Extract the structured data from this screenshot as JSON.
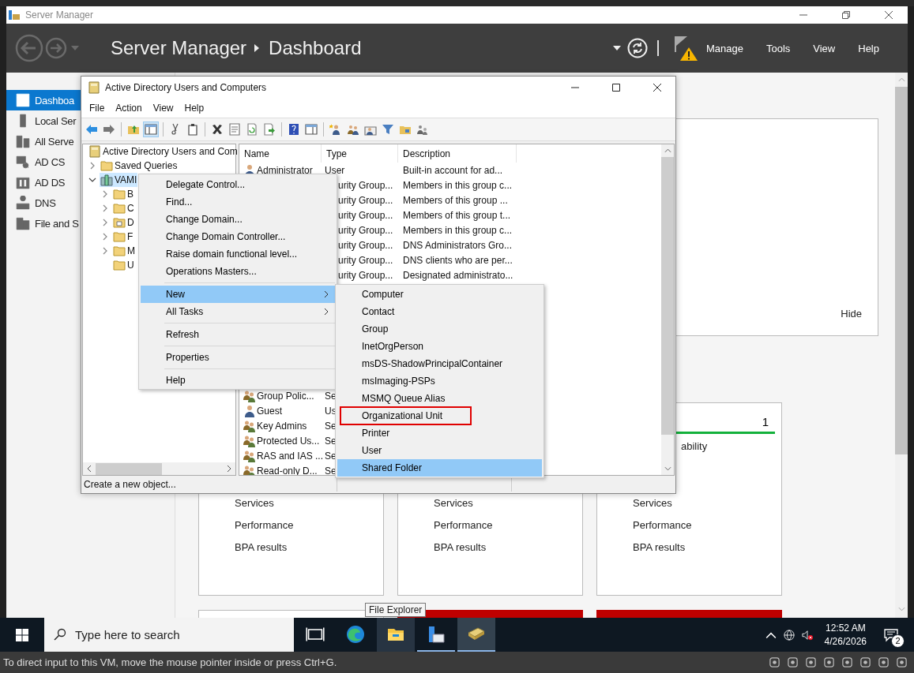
{
  "server_manager": {
    "title": "Server Manager",
    "breadcrumb": [
      "Server Manager",
      "Dashboard"
    ],
    "menu": [
      "Manage",
      "Tools",
      "View",
      "Help"
    ],
    "warning": true,
    "sidebar": [
      {
        "label": "Dashboa",
        "selected": true
      },
      {
        "label": "Local Ser",
        "selected": false
      },
      {
        "label": "All Serve",
        "selected": false
      },
      {
        "label": "AD CS",
        "selected": false
      },
      {
        "label": "AD DS",
        "selected": false
      },
      {
        "label": "DNS",
        "selected": false
      },
      {
        "label": "File and S",
        "selected": false
      }
    ],
    "welcome": {
      "hide": "Hide"
    },
    "tiles": [
      {
        "lines": [
          "Services",
          "Performance",
          "BPA results"
        ]
      },
      {
        "lines": [
          "Services",
          "Performance",
          "BPA results"
        ]
      },
      {
        "count": "1",
        "status": "ability",
        "lines": [
          "Services",
          "Performance",
          "BPA results"
        ]
      }
    ],
    "lower_tiles": [
      {
        "alert": false
      },
      {
        "alert": true
      },
      {
        "alert": true
      }
    ]
  },
  "aduc": {
    "title": "Active Directory Users and Computers",
    "menu": [
      "File",
      "Action",
      "View",
      "Help"
    ],
    "console_tree_pressed": true,
    "tree": [
      {
        "label": "Active Directory Users and Com",
        "kind": "root",
        "selected": false,
        "children": [
          {
            "label": "Saved Queries",
            "kind": "folder",
            "selected": false,
            "expanded": false
          },
          {
            "label": "VAMI",
            "kind": "domain",
            "selected": true,
            "expanded": true,
            "children": [
              {
                "label": "B",
                "kind": "folder",
                "selected": false,
                "expanded": false
              },
              {
                "label": "C",
                "kind": "folder",
                "selected": false,
                "expanded": false
              },
              {
                "label": "D",
                "kind": "ou",
                "selected": false,
                "expanded": false
              },
              {
                "label": "F",
                "kind": "folder",
                "selected": false,
                "expanded": false
              },
              {
                "label": "M",
                "kind": "folder",
                "selected": false,
                "expanded": false
              },
              {
                "label": "U",
                "kind": "folder",
                "selected": false
              }
            ]
          }
        ]
      }
    ],
    "columns": [
      "Name",
      "Type",
      "Description"
    ],
    "rows": [
      {
        "kind": "user",
        "name": "Administrator",
        "type": "User",
        "description": "Built-in account for ad..."
      },
      {
        "type": "urity Group...",
        "description": "Members in this group c..."
      },
      {
        "type": "urity Group...",
        "description": "Members of this group ..."
      },
      {
        "type": "urity Group...",
        "description": "Members of this group t..."
      },
      {
        "type": "urity Group...",
        "description": "Members in this group c..."
      },
      {
        "type": "urity Group...",
        "description": "DNS Administrators Gro..."
      },
      {
        "type": "urity Group...",
        "description": "DNS clients who are per..."
      },
      {
        "type": "urity Group...",
        "description": "Designated administrato..."
      }
    ],
    "rows_below_menu": [
      {
        "kind": "group",
        "name": "Group Polic...",
        "type": "Se"
      },
      {
        "kind": "user",
        "name": "Guest",
        "type": "Us"
      },
      {
        "kind": "group",
        "name": "Key Admins",
        "type": "Se"
      },
      {
        "kind": "group",
        "name": "Protected Us...",
        "type": "Se"
      },
      {
        "kind": "group",
        "name": "RAS and IAS ...",
        "type": "Se"
      },
      {
        "kind": "group",
        "name": "Read-only D...",
        "type": "Se"
      }
    ],
    "status": "Create a new object..."
  },
  "context_menu": [
    [
      {
        "label": "Delegate Control...",
        "selected": false
      },
      {
        "label": "Find...",
        "selected": false
      },
      {
        "label": "Change Domain...",
        "selected": false
      },
      {
        "label": "Change Domain Controller...",
        "selected": false
      },
      {
        "label": "Raise domain functional level...",
        "selected": false
      },
      {
        "label": "Operations Masters...",
        "selected": false
      }
    ],
    [
      {
        "label": "New",
        "selected": true,
        "submenu": true
      },
      {
        "label": "All Tasks",
        "selected": false,
        "submenu": true
      }
    ],
    [
      {
        "label": "Refresh",
        "selected": false
      }
    ],
    [
      {
        "label": "Properties",
        "selected": false
      }
    ],
    [
      {
        "label": "Help",
        "selected": false
      }
    ]
  ],
  "submenu": [
    {
      "label": "Computer",
      "selected": false,
      "outlined": false
    },
    {
      "label": "Contact",
      "selected": false,
      "outlined": false
    },
    {
      "label": "Group",
      "selected": false,
      "outlined": false
    },
    {
      "label": "InetOrgPerson",
      "selected": false,
      "outlined": false
    },
    {
      "label": "msDS-ShadowPrincipalContainer",
      "selected": false,
      "outlined": false
    },
    {
      "label": "msImaging-PSPs",
      "selected": false,
      "outlined": false
    },
    {
      "label": "MSMQ Queue Alias",
      "selected": false,
      "outlined": false
    },
    {
      "label": "Organizational Unit",
      "selected": false,
      "outlined": true
    },
    {
      "label": "Printer",
      "selected": false,
      "outlined": false
    },
    {
      "label": "User",
      "selected": false,
      "outlined": false
    },
    {
      "label": "Shared Folder",
      "selected": true,
      "outlined": false
    }
  ],
  "tooltip": "File Explorer",
  "taskbar": {
    "placeholder": "Type here to search",
    "apps": [
      {
        "kind": "task-view",
        "open": false,
        "selected": false,
        "hovered": false
      },
      {
        "kind": "edge",
        "open": false,
        "selected": false,
        "hovered": false
      },
      {
        "kind": "explorer",
        "open": false,
        "selected": false,
        "hovered": true
      },
      {
        "kind": "server-manager",
        "open": true,
        "selected": false,
        "hovered": false
      },
      {
        "kind": "aduc",
        "open": true,
        "selected": true,
        "hovered": false
      }
    ],
    "time": "12:52 AM",
    "date": "4/26/2026",
    "notifications": "2"
  },
  "host_status": "To direct input to this VM, move the mouse pointer inside or press Ctrl+G."
}
